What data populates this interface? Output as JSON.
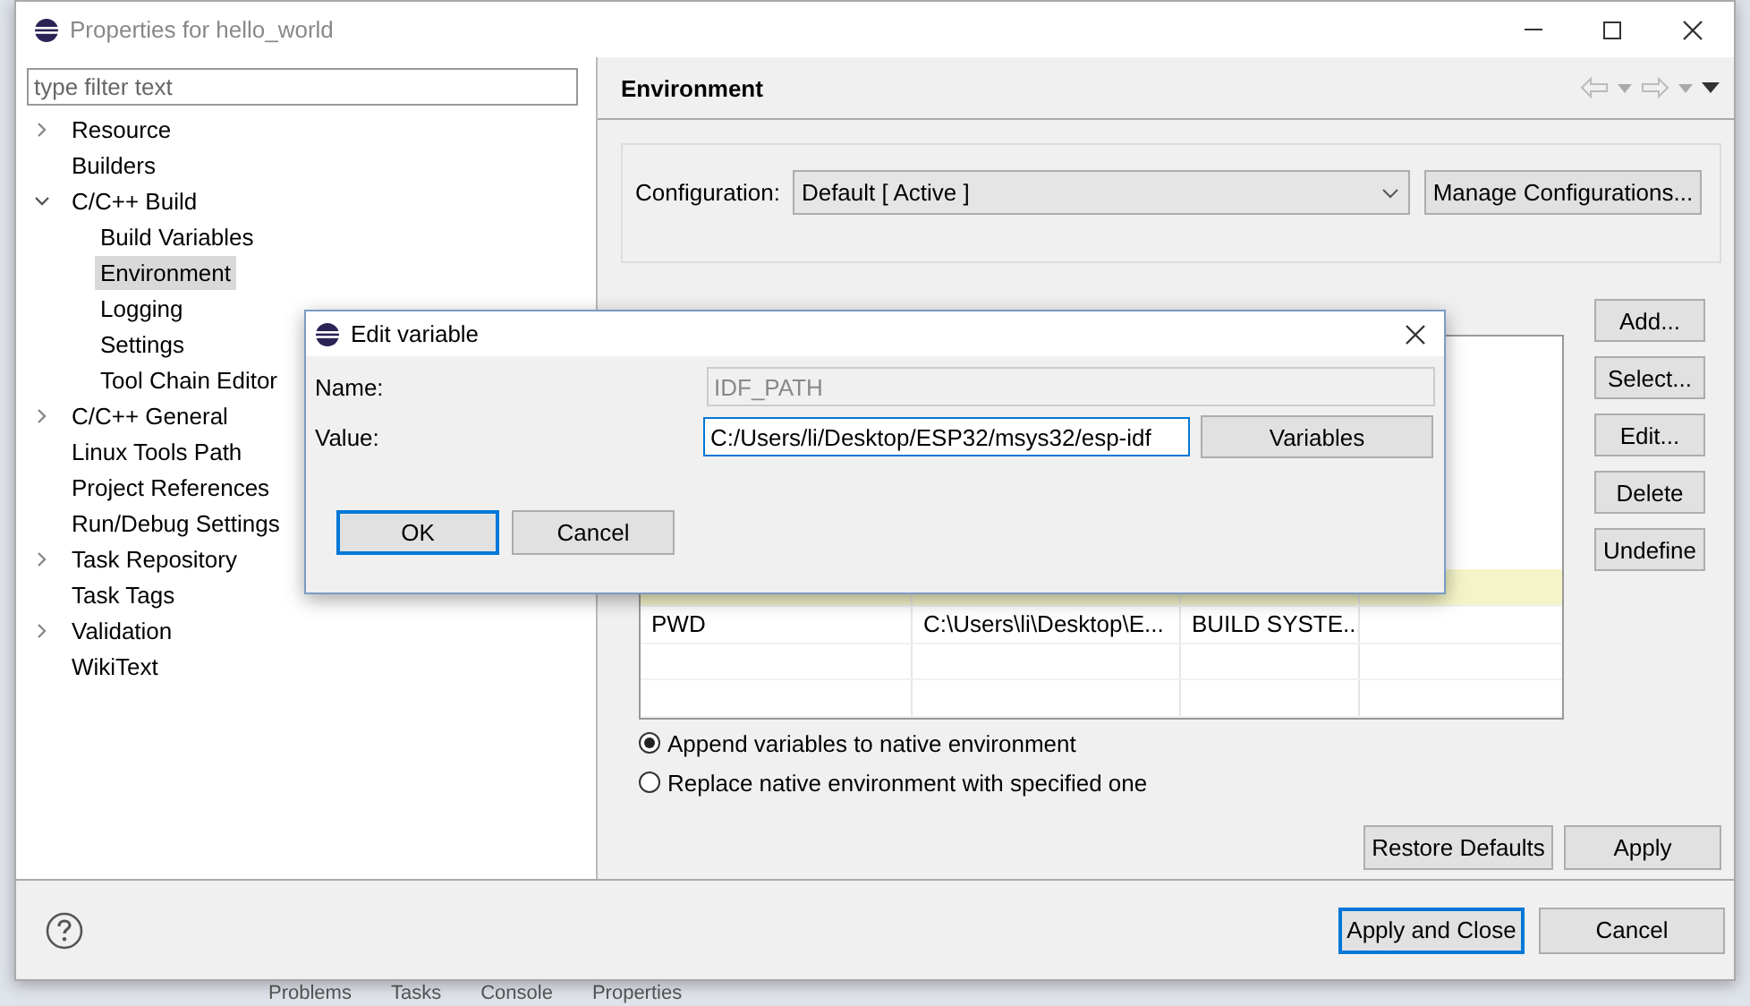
{
  "window": {
    "title": "Properties for hello_world"
  },
  "filter": {
    "placeholder": "type filter text"
  },
  "tree": [
    {
      "label": "Resource",
      "expanded": false,
      "selected": false
    },
    {
      "label": "Builders",
      "selected": false
    },
    {
      "label": "C/C++ Build",
      "expanded": true,
      "selected": false,
      "children": [
        {
          "label": "Build Variables",
          "selected": false
        },
        {
          "label": "Environment",
          "selected": true
        },
        {
          "label": "Logging",
          "selected": false
        },
        {
          "label": "Settings",
          "selected": false
        },
        {
          "label": "Tool Chain Editor",
          "selected": false
        }
      ]
    },
    {
      "label": "C/C++ General",
      "expanded": false,
      "selected": false
    },
    {
      "label": "Linux Tools Path",
      "selected": false
    },
    {
      "label": "Project References",
      "selected": false
    },
    {
      "label": "Run/Debug Settings",
      "selected": false
    },
    {
      "label": "Task Repository",
      "expanded": false,
      "selected": false
    },
    {
      "label": "Task Tags",
      "selected": false
    },
    {
      "label": "Validation",
      "expanded": false,
      "selected": false
    },
    {
      "label": "WikiText",
      "selected": false
    }
  ],
  "page": {
    "title": "Environment",
    "configuration_label": "Configuration:",
    "configuration": "Default  [ Active ]",
    "manage_button": "Manage Configurations..."
  },
  "table": {
    "rows": [
      {
        "selected": true
      },
      {
        "selected": false,
        "cells": [
          "PWD",
          "C:\\Users\\li\\Desktop\\E...",
          "BUILD SYSTE..."
        ]
      }
    ]
  },
  "side_buttons": [
    "Add...",
    "Select...",
    "Edit...",
    "Delete",
    "Undefine"
  ],
  "radios": [
    {
      "label": "Append variables to native environment",
      "selected": true
    },
    {
      "label": "Replace native environment with specified one",
      "selected": false
    }
  ],
  "page_buttons": [
    "Restore Defaults",
    "Apply"
  ],
  "footer_buttons": [
    {
      "label": "Apply and Close",
      "default": true
    },
    {
      "label": "Cancel",
      "default": false
    }
  ],
  "dialog": {
    "title": "Edit variable",
    "name_label": "Name:",
    "name": "IDF_PATH",
    "name_disabled": true,
    "value_label": "Value:",
    "value": "C:/Users/li/Desktop/ESP32/msys32/esp-idf",
    "variables_button": "Variables",
    "buttons": [
      {
        "label": "OK",
        "default": true
      },
      {
        "label": "Cancel",
        "default": false
      }
    ]
  },
  "background_tabs": [
    "Problems",
    "Tasks",
    "Console",
    "Properties"
  ]
}
